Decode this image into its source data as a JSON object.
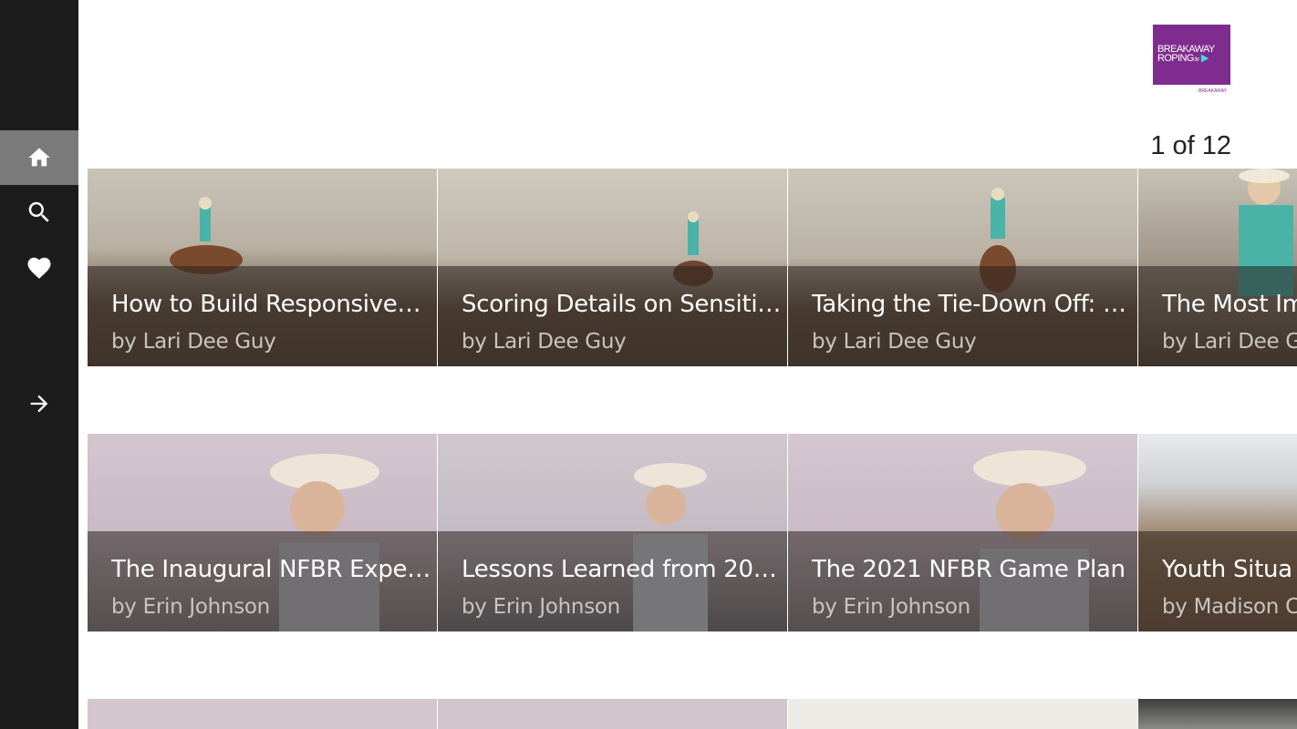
{
  "sidebar": {
    "items": [
      {
        "name": "home",
        "icon": "home-icon",
        "active": true
      },
      {
        "name": "search",
        "icon": "search-icon"
      },
      {
        "name": "favorites",
        "icon": "heart-icon"
      },
      {
        "name": "expand",
        "icon": "arrow-right-icon"
      }
    ]
  },
  "logo": {
    "line1": "BREAKAWAY",
    "line2": "ROPING",
    "suffix": ".tv",
    "small": "BREAKAWAY"
  },
  "pager": {
    "label": "1 of 12"
  },
  "rows": [
    {
      "cards": [
        {
          "title": "How to Build Responsiven…",
          "author": "by Lari Dee Guy"
        },
        {
          "title": "Scoring Details on Sensiti…",
          "author": "by Lari Dee Guy"
        },
        {
          "title": "Taking the Tie-Down Off: …",
          "author": "by Lari Dee Guy"
        },
        {
          "title": "The Most Im",
          "author": "by Lari Dee G"
        }
      ]
    },
    {
      "cards": [
        {
          "title": "The Inaugural NFBR Exper…",
          "author": "by Erin Johnson"
        },
        {
          "title": "Lessons Learned from 202…",
          "author": "by Erin Johnson"
        },
        {
          "title": "The 2021 NFBR Game Plan",
          "author": "by Erin Johnson"
        },
        {
          "title": "Youth Situa",
          "author": "by Madison C"
        }
      ]
    },
    {
      "cards": [
        {
          "title": "",
          "author": ""
        },
        {
          "title": "",
          "author": ""
        },
        {
          "title": "",
          "author": ""
        },
        {
          "title": "",
          "author": ""
        }
      ]
    }
  ],
  "colors": {
    "sidebar": "#1c1c1c",
    "active_nav": "#7a7a7a",
    "brand": "#7e2d8e"
  }
}
